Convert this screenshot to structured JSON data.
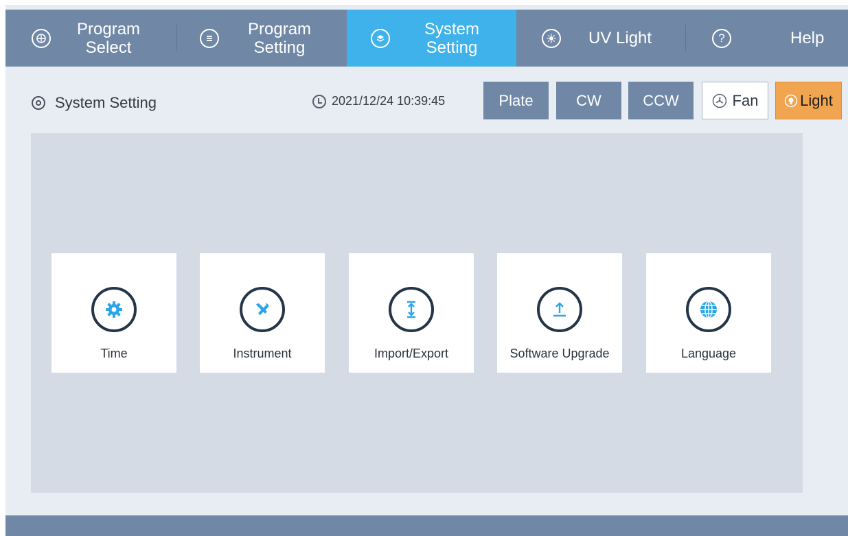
{
  "nav": {
    "tabs": [
      {
        "label": "Program\nSelect",
        "icon": "program-select-icon"
      },
      {
        "label": "Program\nSetting",
        "icon": "program-setting-icon"
      },
      {
        "label": "System\nSetting",
        "icon": "system-setting-icon",
        "active": true
      },
      {
        "label": "UV Light",
        "icon": "uv-light-icon"
      },
      {
        "label": "Help",
        "icon": "help-icon"
      }
    ]
  },
  "header": {
    "title": "System Setting",
    "datetime": "2021/12/24 10:39:45"
  },
  "controls": {
    "plate": "Plate",
    "cw": "CW",
    "ccw": "CCW",
    "fan": "Fan",
    "light": "Light"
  },
  "cards": [
    {
      "label": "Time",
      "icon": "gear-icon"
    },
    {
      "label": "Instrument",
      "icon": "tools-icon"
    },
    {
      "label": "Import/Export",
      "icon": "import-export-icon"
    },
    {
      "label": "Software Upgrade",
      "icon": "upload-icon"
    },
    {
      "label": "Language",
      "icon": "globe-icon"
    }
  ],
  "colors": {
    "nav_bg": "#7087a6",
    "nav_active": "#3fb2eb",
    "panel_bg": "#d4dbe5",
    "light_button": "#f2a551",
    "icon_blue": "#2aa6e6"
  }
}
